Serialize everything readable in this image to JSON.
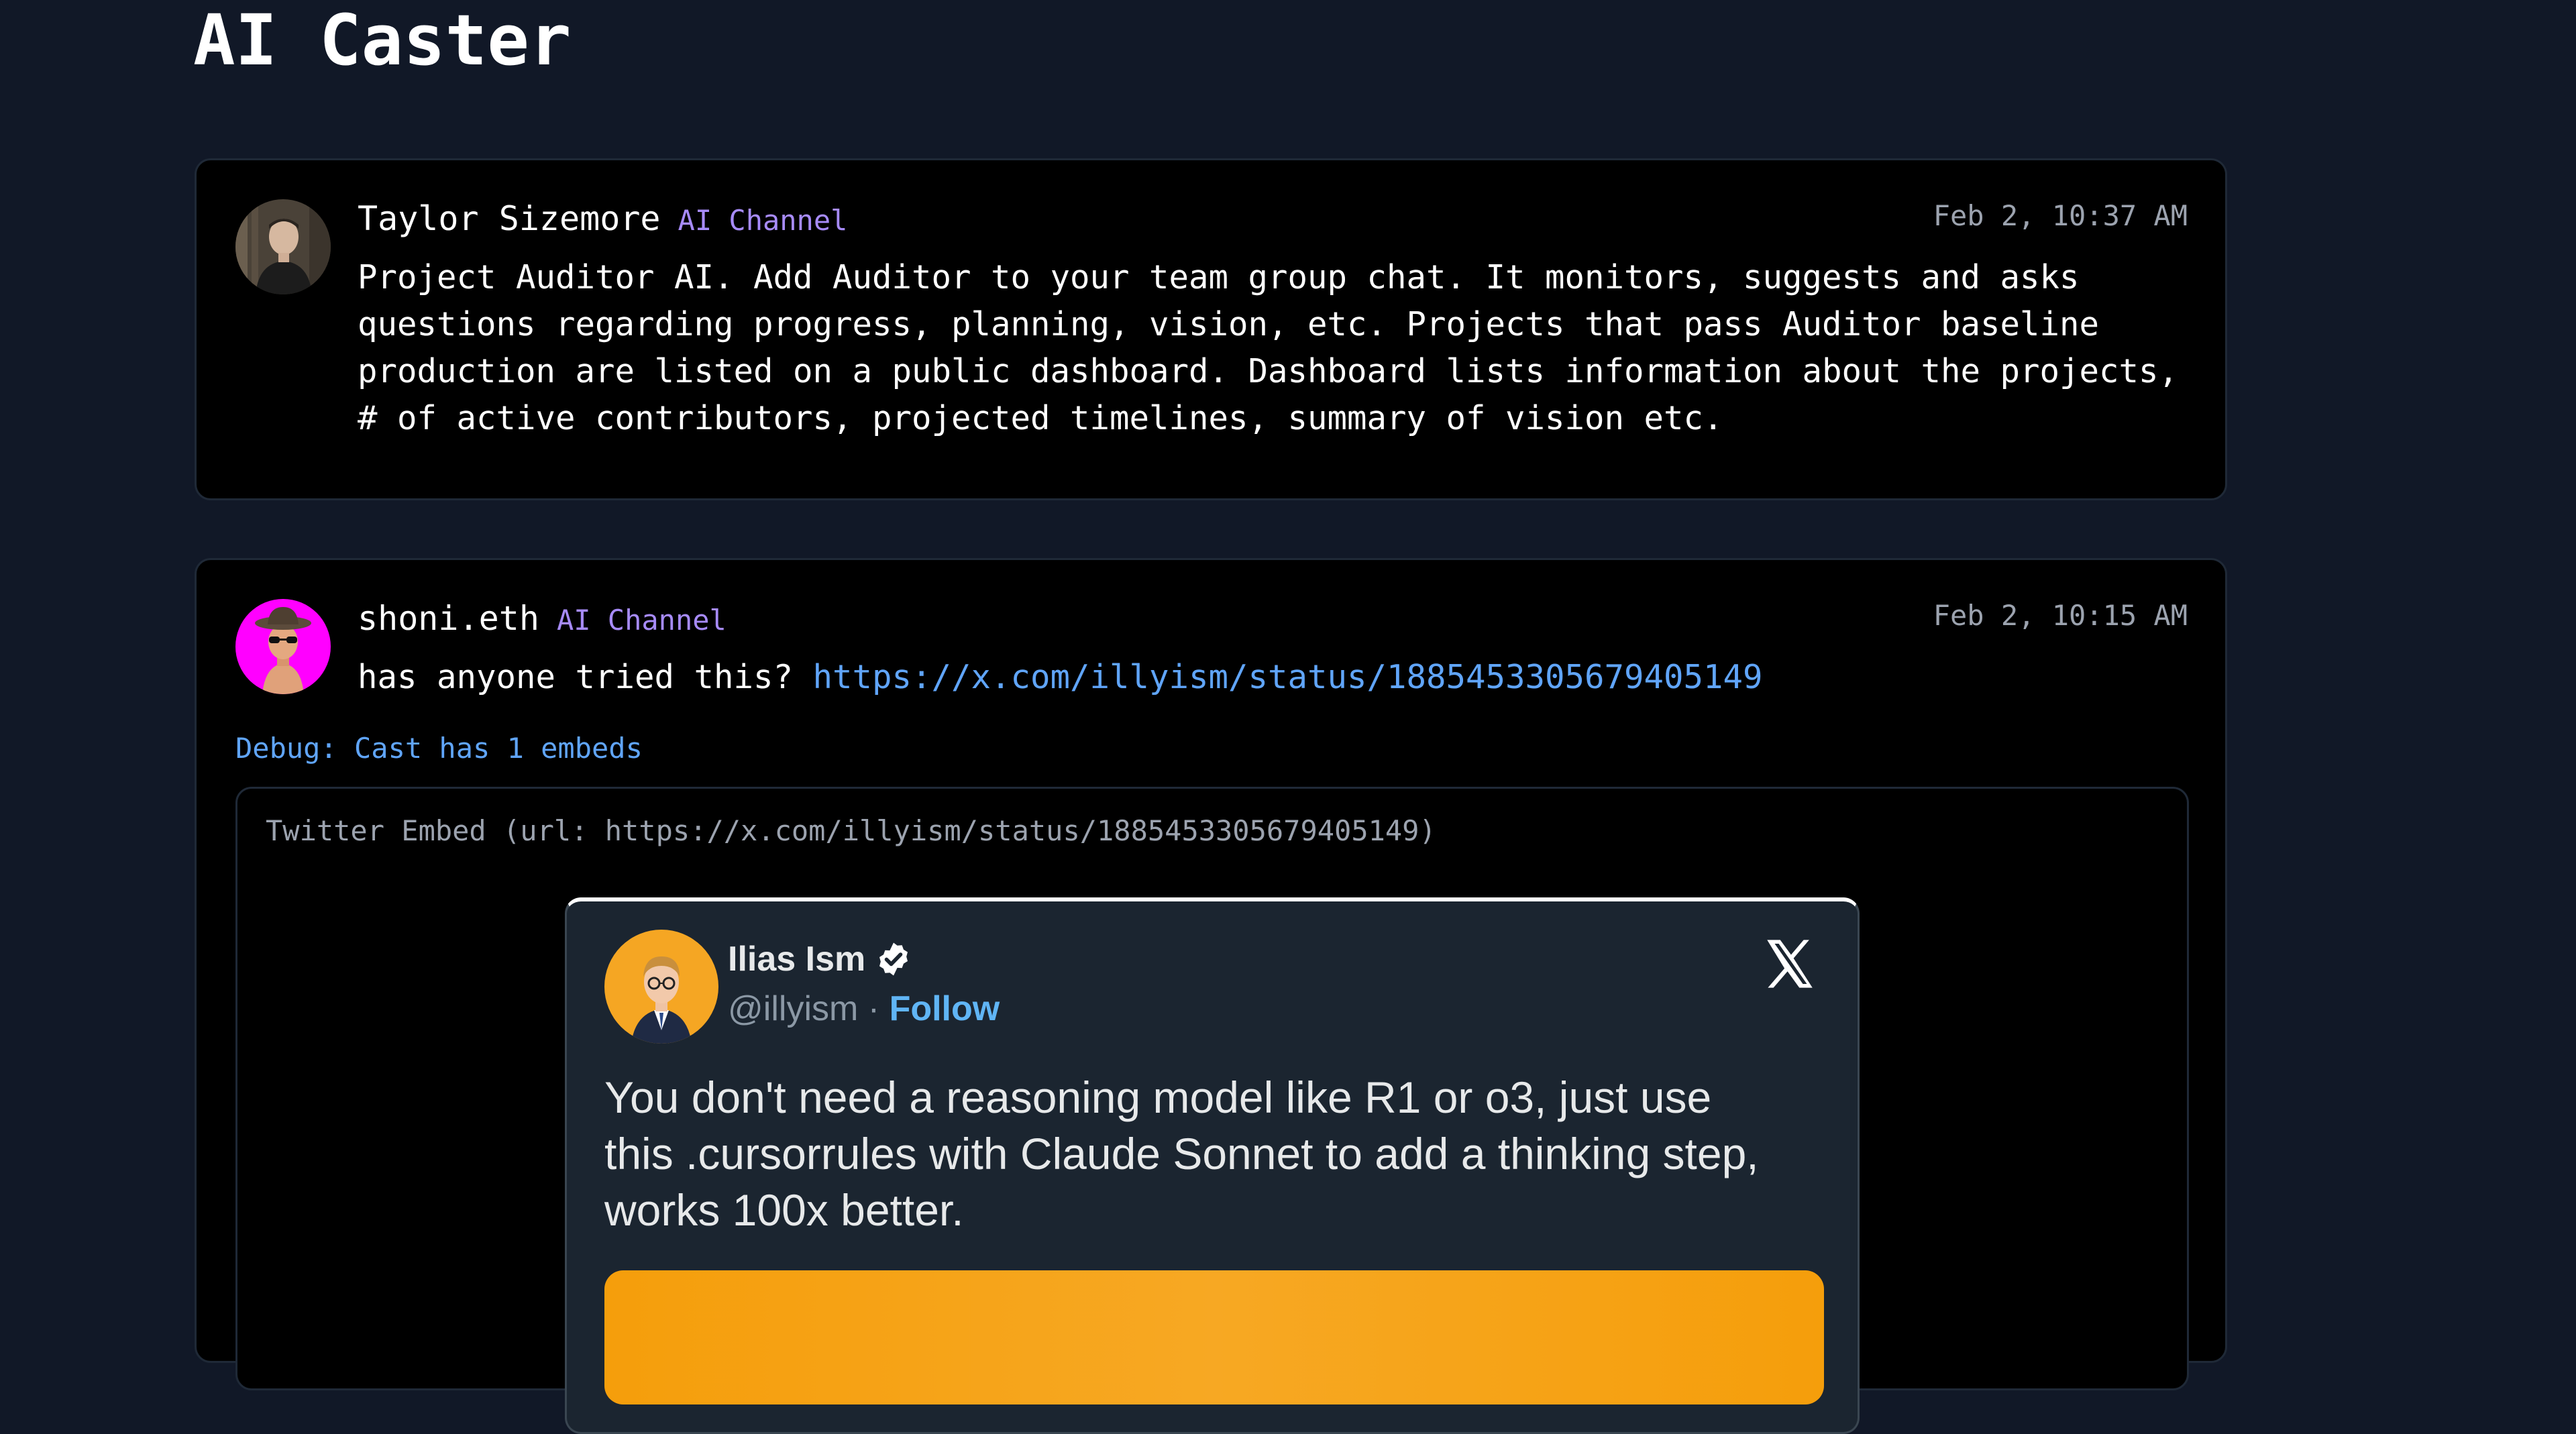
{
  "page": {
    "title": "AI Caster"
  },
  "casts": [
    {
      "author": "Taylor Sizemore",
      "channel": "AI Channel",
      "timestamp": "Feb 2, 10:37 AM",
      "text_lines": [
        "Project Auditor AI. Add Auditor to your team group chat. It monitors, suggests and asks",
        "questions regarding progress, planning, vision, etc. Projects that pass Auditor baseline",
        "production are listed on a public dashboard. Dashboard lists information about the projects,",
        "# of active contributors, projected timelines, summary of vision etc."
      ]
    },
    {
      "author": "shoni.eth",
      "channel": "AI Channel",
      "timestamp": "Feb 2, 10:15 AM",
      "text": "has anyone tried this?",
      "link": "https://x.com/illyism/status/1885453305679405149",
      "debug": "Debug: Cast has 1 embeds",
      "embed": {
        "label": "Twitter Embed (url: https://x.com/illyism/status/1885453305679405149)",
        "tweet": {
          "name": "Ilias Ism",
          "handle": "@illyism",
          "separator": "·",
          "follow": "Follow",
          "text_lines": [
            "You don't need a reasoning model like R1 or o3, just use",
            "this .cursorrules with Claude Sonnet to add a thinking step,",
            "works 100x better."
          ]
        }
      }
    }
  ],
  "icons": {
    "verified": "verified-badge-icon",
    "x_logo": "x-logo-icon"
  },
  "colors": {
    "background": "#111827",
    "card": "#000000",
    "channel": "#a78bfa",
    "link": "#60a5fa",
    "tweet_bg": "#1b2530",
    "follow": "#60b5f5",
    "media_accent": "#f59e0b",
    "avatar_shoni": "#ff00ff",
    "avatar_ilias": "#f5a623"
  }
}
